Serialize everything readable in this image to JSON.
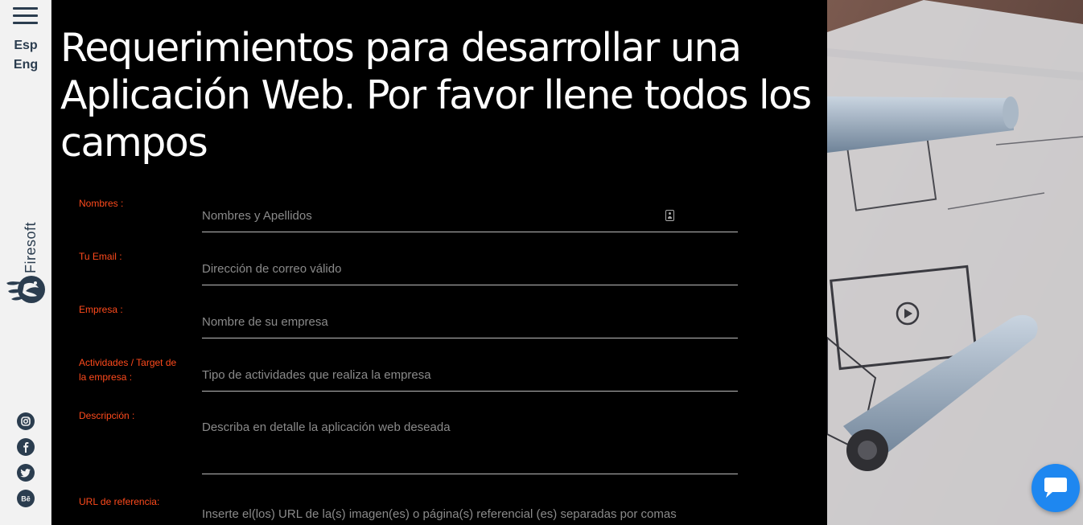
{
  "sidebar": {
    "menu_icon": "hamburger-icon",
    "languages": [
      "Esp",
      "Eng"
    ],
    "brand": "Firesoft",
    "social_icons": [
      "instagram-icon",
      "facebook-icon",
      "twitter-icon",
      "behance-icon"
    ]
  },
  "main": {
    "title": "Requerimientos para desarrollar una Aplicación Web. Por favor llene todos los campos",
    "form": {
      "fields": [
        {
          "label": "Nombres :",
          "placeholder": "Nombres y Apellidos"
        },
        {
          "label": "Tu Email :",
          "placeholder": "Dirección de correo válido"
        },
        {
          "label": "Empresa :",
          "placeholder": "Nombre de su empresa"
        },
        {
          "label": "Actividades / Target de la empresa :",
          "placeholder": "Tipo de actividades que realiza la empresa"
        },
        {
          "label": "Descripción :",
          "placeholder": "Describa en detalle la aplicación web deseada"
        },
        {
          "label": "URL de referencia:",
          "placeholder": "Inserte el(los) URL de la(s) imagen(es) o página(s) referencial (es) separadas por comas"
        }
      ]
    }
  },
  "chat": {
    "icon": "chat-bubble-icon"
  },
  "colors": {
    "label": "#ff4a1c",
    "sidebar_bg": "#f2f2f2",
    "sidebar_text": "#2b3d4f",
    "chat_button": "#1e87f0"
  }
}
